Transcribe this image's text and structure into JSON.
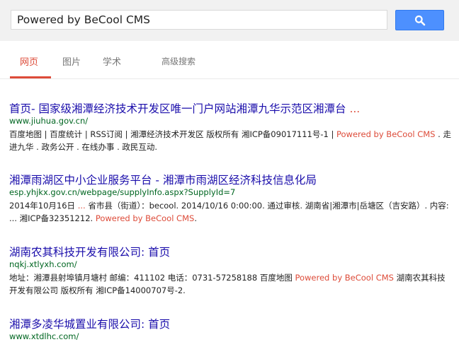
{
  "search": {
    "query": "Powered by BeCool CMS"
  },
  "tabs": {
    "web": "网页",
    "images": "图片",
    "scholar": "学术",
    "advanced": "高级搜索"
  },
  "results": [
    {
      "title": "首页- 国家级湘潭经济技术开发区唯一门户网站湘潭九华示范区湘潭台",
      "title_ellipsis": " ...",
      "url": "www.jiuhua.gov.cn/",
      "snippet_a": "百度地图 | 百度统计 | RSS订阅 | 湘潭经济技术开发区 版权所有 湘ICP备09017111号-1 | ",
      "snippet_hl": "Powered by BeCool CMS",
      "snippet_b": " . 走进九华 . 政务公开 . 在线办事 . 政民互动."
    },
    {
      "title": "湘潭雨湖区中小企业服务平台 - 湘潭市雨湖区经济科技信息化局",
      "url": "esp.yhjkx.gov.cn/webpage/supplyInfo.aspx?SupplyId=7",
      "snippet_a": "2014年10月16日 ",
      "snippet_hl_a": "...",
      "snippet_b": " 省市县（街道）：becool. 2014/10/16 0:00:00. 通过审核. 湖南省|湘潭市|岳塘区（吉安路）. 内容: ... 湘ICP备32351212. ",
      "snippet_hl": "Powered by BeCool CMS",
      "snippet_c": "."
    },
    {
      "title": "湖南农其科技开发有限公司: 首页",
      "url": "nqkj.xtlyxh.com/",
      "snippet_a": "地址：湘潭县射埠镇月塘村 邮编：411102 电话：0731-57258188 百度地图 ",
      "snippet_hl": "Powered by BeCool CMS",
      "snippet_b": " 湖南农其科技开发有限公司 版权所有 湘ICP备14000707号-2."
    },
    {
      "title": "湘潭多凌华城置业有限公司: 首页",
      "url": "www.xtdlhc.com/"
    }
  ]
}
